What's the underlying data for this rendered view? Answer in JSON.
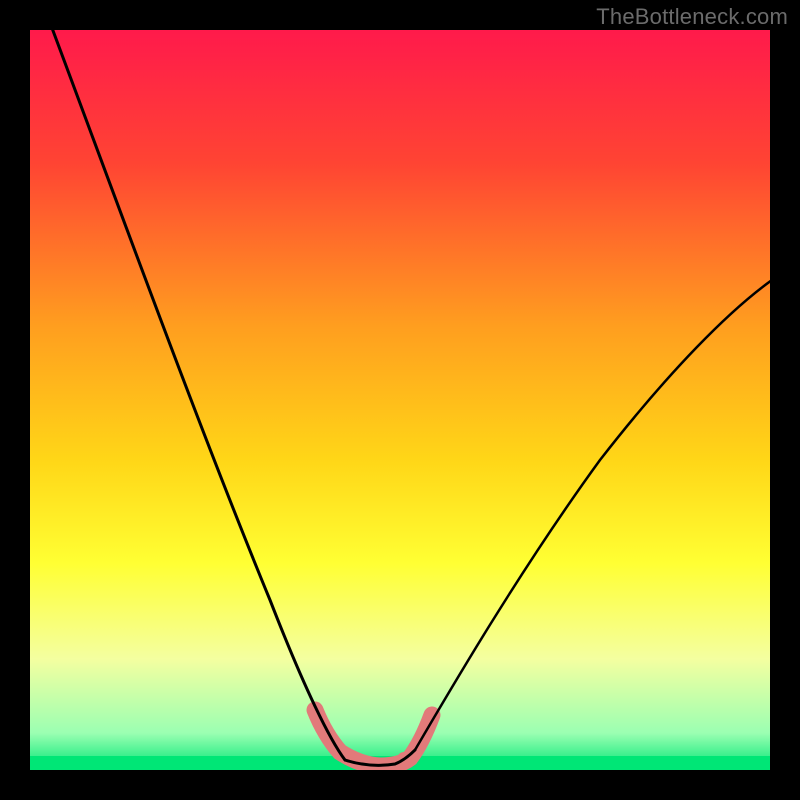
{
  "watermark": "TheBottleneck.com",
  "chart_data": {
    "type": "line",
    "title": "",
    "xlabel": "",
    "ylabel": "",
    "xlim": [
      0,
      100
    ],
    "ylim": [
      0,
      100
    ],
    "background_gradient": {
      "stops": [
        {
          "offset": 0.0,
          "color": "#ff1a4b"
        },
        {
          "offset": 0.18,
          "color": "#ff4433"
        },
        {
          "offset": 0.4,
          "color": "#ff9e1f"
        },
        {
          "offset": 0.58,
          "color": "#ffd617"
        },
        {
          "offset": 0.72,
          "color": "#ffff33"
        },
        {
          "offset": 0.85,
          "color": "#f4ffa0"
        },
        {
          "offset": 0.95,
          "color": "#9bffb2"
        },
        {
          "offset": 1.0,
          "color": "#00e676"
        }
      ]
    },
    "series": [
      {
        "name": "curve-left",
        "x": [
          3,
          6,
          9,
          12,
          15,
          18,
          21,
          24,
          27,
          30,
          33,
          36,
          38.5,
          40.5,
          42
        ],
        "y": [
          100,
          92,
          84,
          76,
          68,
          60,
          52,
          44,
          36,
          28,
          20,
          12,
          6,
          2,
          0.5
        ]
      },
      {
        "name": "curve-right",
        "x": [
          49.5,
          51,
          53,
          56,
          60,
          65,
          70,
          76,
          82,
          88,
          94,
          100
        ],
        "y": [
          0.5,
          2,
          5,
          9,
          15,
          22,
          29,
          37,
          45,
          52,
          59,
          65
        ]
      },
      {
        "name": "valley-mark",
        "x": [
          38.5,
          40,
          42,
          44,
          46,
          48,
          49.5,
          51,
          53
        ],
        "y": [
          6,
          3,
          1,
          0.4,
          0.4,
          0.8,
          2,
          4,
          6
        ]
      }
    ],
    "colors": {
      "curve": "#000000",
      "valley_stroke": "#e27a7a",
      "green_band": "#00e676"
    }
  }
}
